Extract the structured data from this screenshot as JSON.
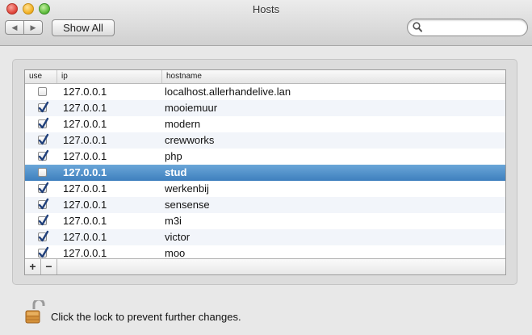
{
  "window": {
    "title": "Hosts"
  },
  "toolbar": {
    "back_icon": "◀",
    "forward_icon": "▶",
    "show_all_label": "Show All",
    "search_placeholder": ""
  },
  "table": {
    "columns": [
      "use",
      "ip",
      "hostname"
    ],
    "rows": [
      {
        "use": false,
        "ip": "127.0.0.1",
        "hostname": "localhost.allerhandelive.lan"
      },
      {
        "use": true,
        "ip": "127.0.0.1",
        "hostname": "mooiemuur"
      },
      {
        "use": true,
        "ip": "127.0.0.1",
        "hostname": "modern"
      },
      {
        "use": true,
        "ip": "127.0.0.1",
        "hostname": "crewworks"
      },
      {
        "use": true,
        "ip": "127.0.0.1",
        "hostname": "php"
      },
      {
        "use": false,
        "ip": "127.0.0.1",
        "hostname": "stud",
        "selected": true
      },
      {
        "use": true,
        "ip": "127.0.0.1",
        "hostname": "werkenbij"
      },
      {
        "use": true,
        "ip": "127.0.0.1",
        "hostname": "sensense"
      },
      {
        "use": true,
        "ip": "127.0.0.1",
        "hostname": "m3i"
      },
      {
        "use": true,
        "ip": "127.0.0.1",
        "hostname": "victor"
      },
      {
        "use": true,
        "ip": "127.0.0.1",
        "hostname": "moo"
      }
    ],
    "add_label": "+",
    "remove_label": "−"
  },
  "footer": {
    "lock_text": "Click the lock to prevent further changes."
  },
  "colors": {
    "selection": "#3e7fbe",
    "checkmark": "#1f3f7a"
  }
}
